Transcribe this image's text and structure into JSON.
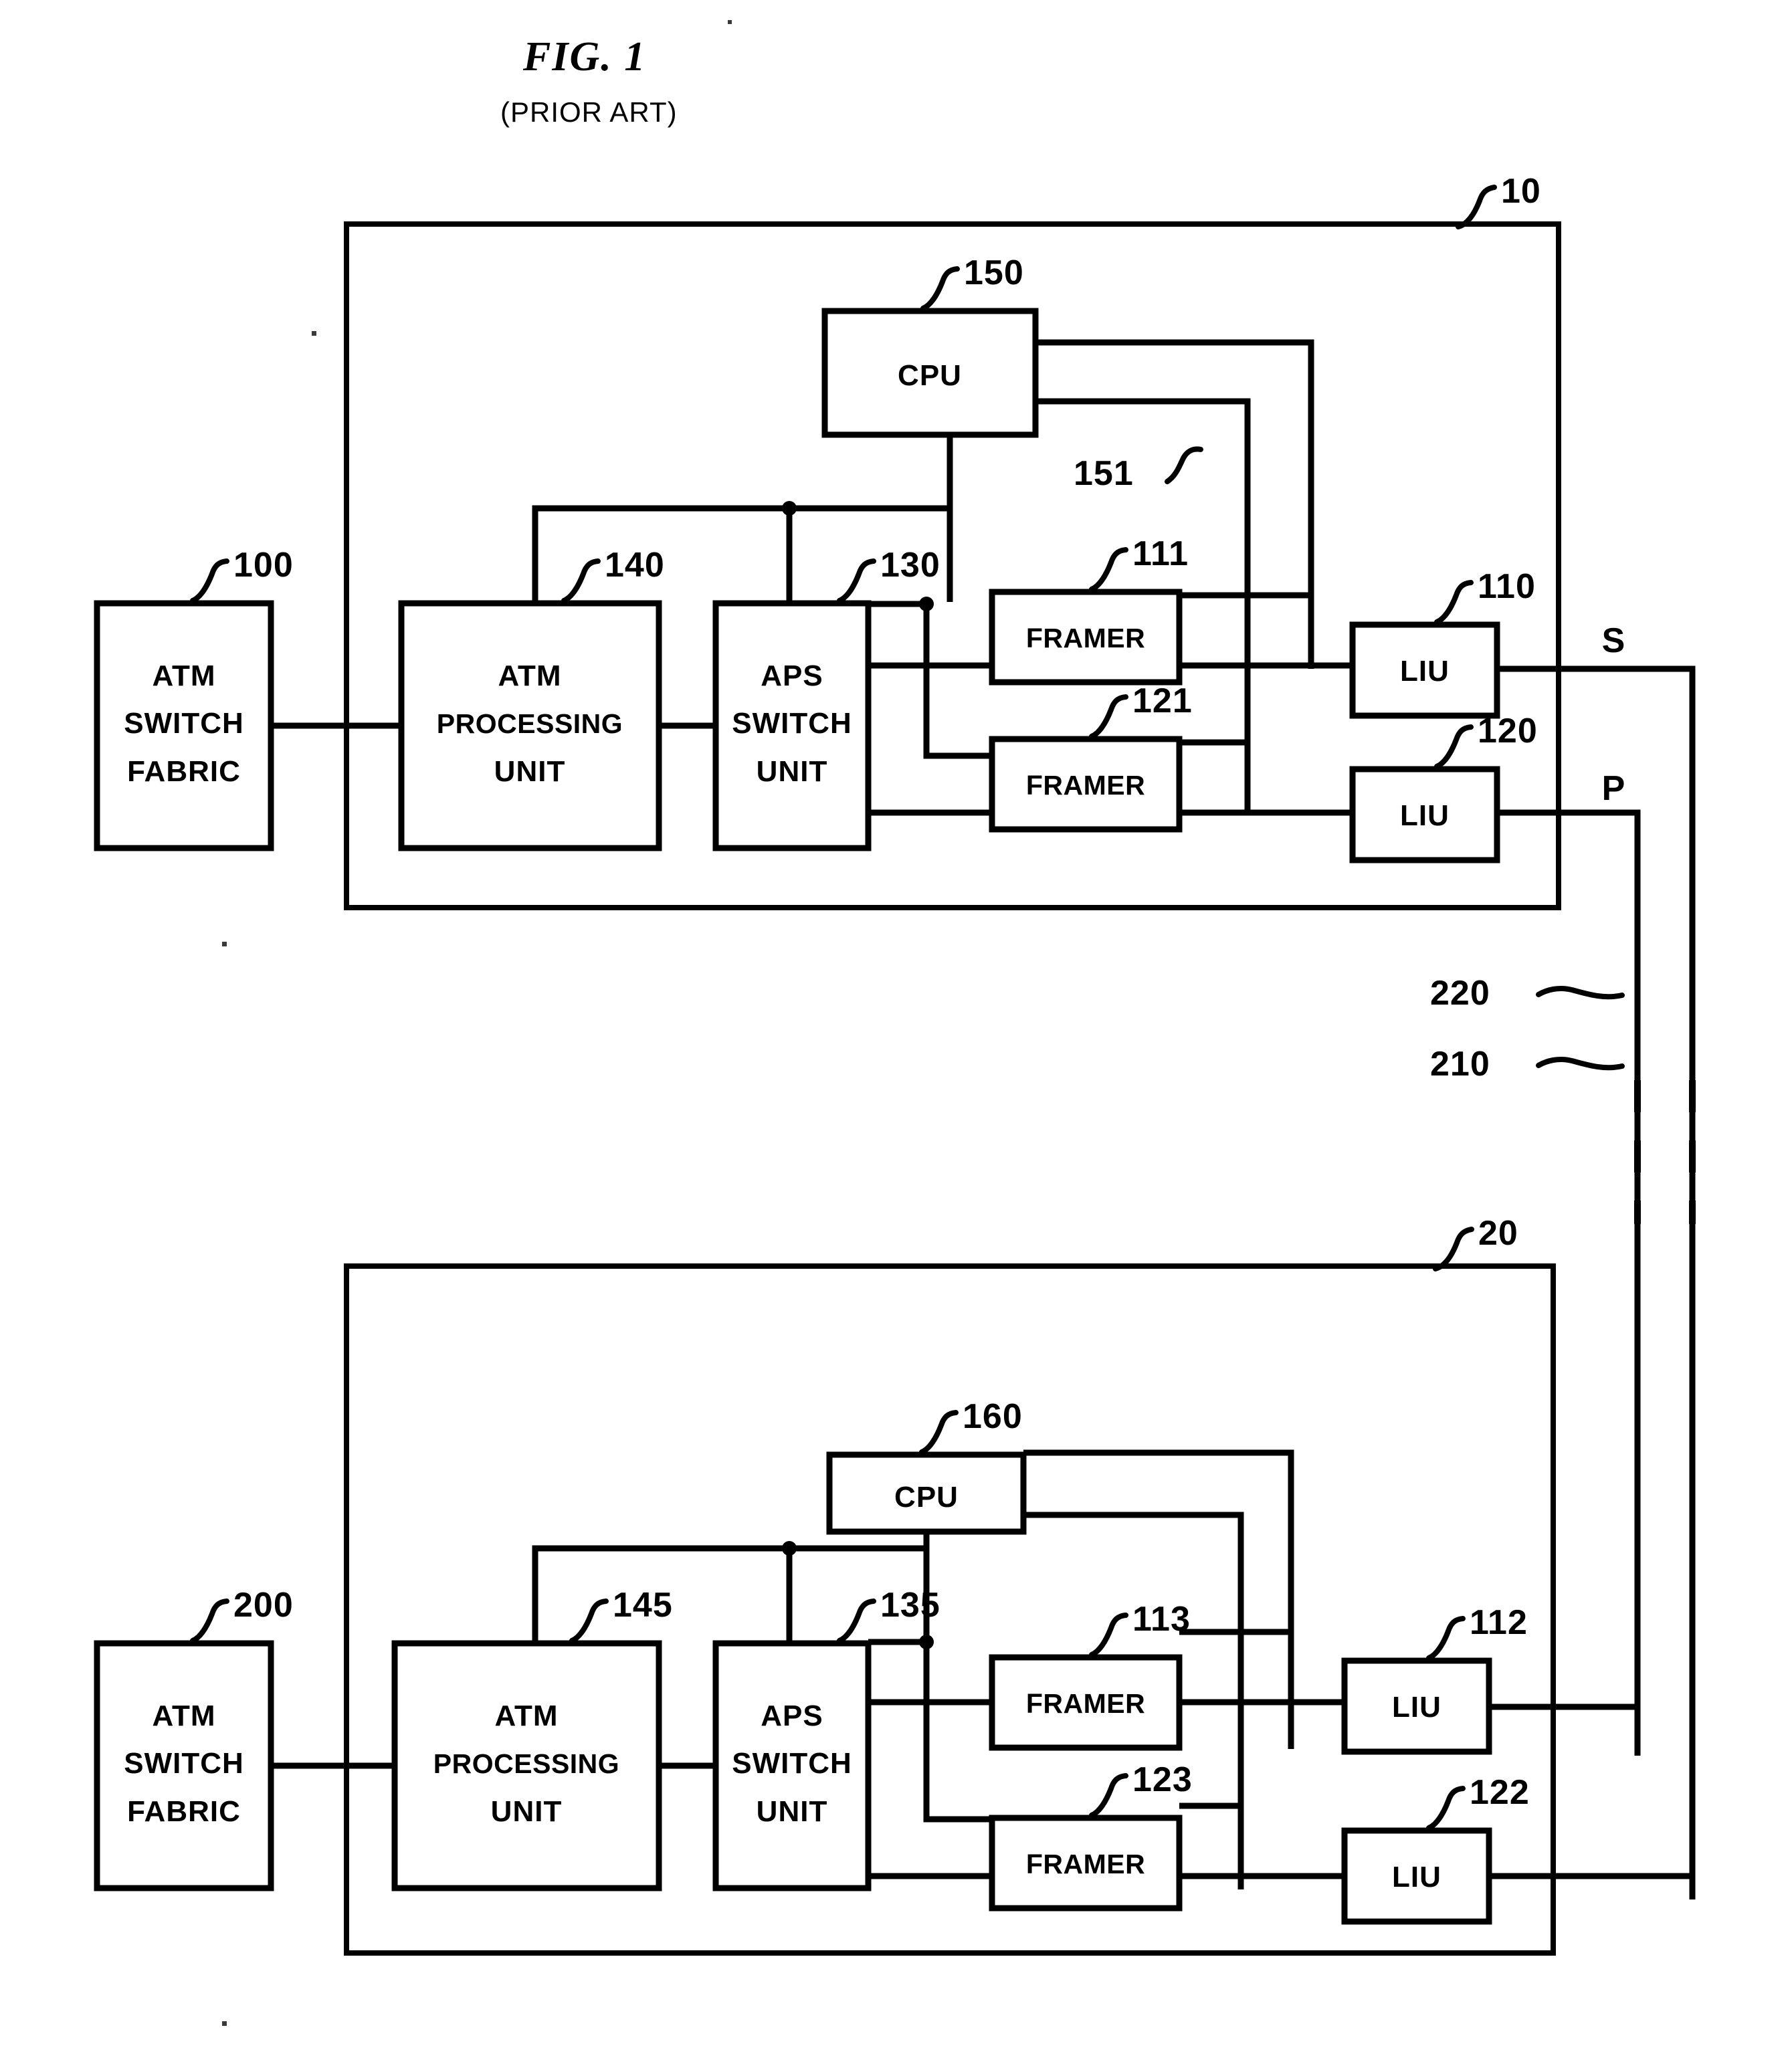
{
  "figure": {
    "title": "FIG.  1",
    "subtitle": "(PRIOR ART)"
  },
  "ports": {
    "secondary": "S",
    "primary": "P"
  },
  "links": {
    "label_220": "220",
    "label_210": "210"
  },
  "top_node": {
    "ref": "10",
    "switch_fabric": {
      "ref": "100",
      "line1": "ATM",
      "line2": "SWITCH",
      "line3": "FABRIC"
    },
    "processing_unit": {
      "ref": "140",
      "line1": "ATM",
      "line2": "PROCESSING",
      "line3": "UNIT"
    },
    "aps_switch_unit": {
      "ref": "130",
      "line1": "APS",
      "line2": "SWITCH",
      "line3": "UNIT"
    },
    "cpu": {
      "ref": "150",
      "label": "CPU"
    },
    "cpu_bus_ref": "151",
    "framer_primary": {
      "ref": "111",
      "label": "FRAMER"
    },
    "framer_secondary": {
      "ref": "121",
      "label": "FRAMER"
    },
    "liu_primary": {
      "ref": "110",
      "label": "LIU"
    },
    "liu_secondary": {
      "ref": "120",
      "label": "LIU"
    }
  },
  "bottom_node": {
    "ref": "20",
    "switch_fabric": {
      "ref": "200",
      "line1": "ATM",
      "line2": "SWITCH",
      "line3": "FABRIC"
    },
    "processing_unit": {
      "ref": "145",
      "line1": "ATM",
      "line2": "PROCESSING",
      "line3": "UNIT"
    },
    "aps_switch_unit": {
      "ref": "135",
      "line1": "APS",
      "line2": "SWITCH",
      "line3": "UNIT"
    },
    "cpu": {
      "ref": "160",
      "label": "CPU"
    },
    "framer_primary": {
      "ref": "113",
      "label": "FRAMER"
    },
    "framer_secondary": {
      "ref": "123",
      "label": "FRAMER"
    },
    "liu_primary": {
      "ref": "112",
      "label": "LIU"
    },
    "liu_secondary": {
      "ref": "122",
      "label": "LIU"
    }
  },
  "colors": {
    "ink": "#000000",
    "paper": "#ffffff"
  }
}
